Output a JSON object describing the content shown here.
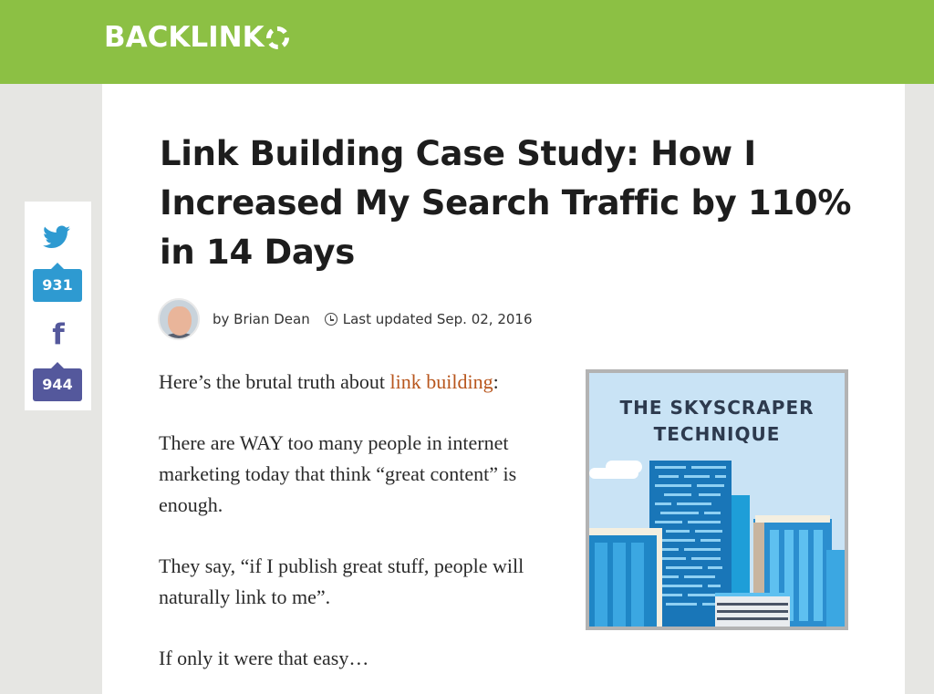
{
  "brand": {
    "logo_text": "BACKLINK",
    "logo_color": "#8cc044"
  },
  "article": {
    "title": "Link Building Case Study: How I Increased My Search Traffic by 110% in 14 Days",
    "author": "by Brian Dean",
    "updated": "Last updated Sep. 02, 2016",
    "intro_prefix": "Here’s the brutal truth about ",
    "intro_link": "link building",
    "intro_suffix": ":",
    "paragraph_2": "There are WAY too many people in internet marketing today that think “great content” is enough.",
    "paragraph_3": "They say, “if I publish great stuff, people will naturally link to me”.",
    "paragraph_4": "If only it were that easy…",
    "link_color": "#b8561d"
  },
  "featured_image": {
    "title_line_1": "THE SKYSCRAPER",
    "title_line_2": "TECHNIQUE"
  },
  "share": {
    "twitter_count": "931",
    "facebook_count": "944",
    "twitter_icon": "twitter-bird-icon",
    "facebook_icon": "facebook-f-icon",
    "twitter_color": "#2e9ad1",
    "facebook_color": "#54589c"
  }
}
